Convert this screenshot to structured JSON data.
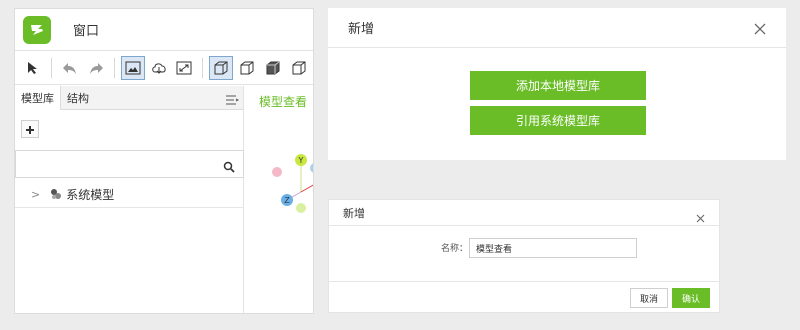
{
  "window": {
    "title": "窗口"
  },
  "left_panel": {
    "tabs": [
      {
        "label": "模型库"
      },
      {
        "label": "结构"
      }
    ],
    "search": {
      "value": "",
      "placeholder": ""
    },
    "tree": [
      {
        "label": "系统模型"
      }
    ]
  },
  "viewport": {
    "title": "模型查看",
    "axes": {
      "y": "Y",
      "z": "Z"
    }
  },
  "dialog_large": {
    "title": "新增",
    "buttons": [
      {
        "label": "添加本地模型库"
      },
      {
        "label": "引用系统模型库"
      }
    ]
  },
  "dialog_small": {
    "title": "新增",
    "name_label": "名称：",
    "name_value": "模型查看",
    "cancel_label": "取消",
    "ok_label": "确认"
  },
  "colors": {
    "accent": "#6abd27",
    "active_tool_bg": "#dbe7f4",
    "active_tool_border": "#7ea6cf"
  },
  "icons": [
    "logo-icon",
    "cursor-icon",
    "undo-icon",
    "redo-icon",
    "image-icon",
    "cloud-icon",
    "resize-icon",
    "cube-icon",
    "menu-icon",
    "plus-icon",
    "search-icon",
    "chevron-right-icon",
    "model-icon",
    "close-icon"
  ]
}
